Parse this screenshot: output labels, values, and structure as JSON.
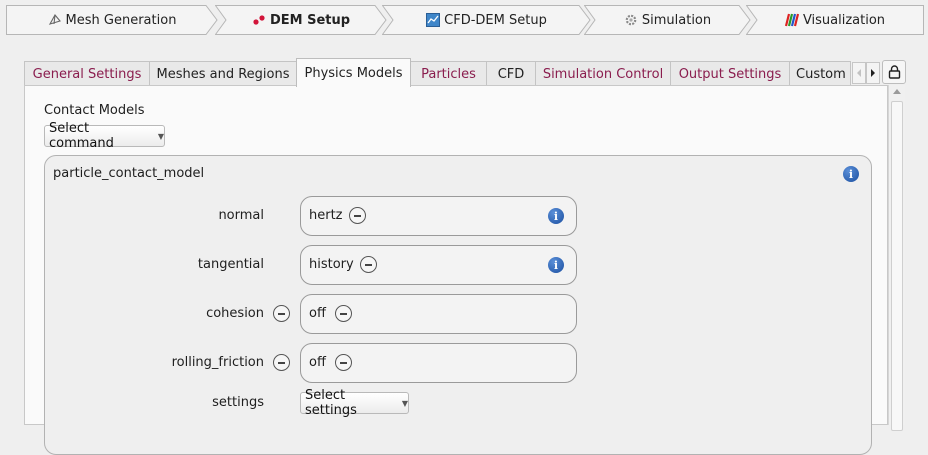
{
  "workflow": {
    "steps": [
      {
        "label": "Mesh Generation",
        "icon": "mesh-icon"
      },
      {
        "label": "DEM Setup",
        "icon": "particles-icon",
        "active": true
      },
      {
        "label": "CFD-DEM Setup",
        "icon": "chart-icon"
      },
      {
        "label": "Simulation",
        "icon": "gear-icon"
      },
      {
        "label": "Visualization",
        "icon": "paraview-icon"
      }
    ]
  },
  "tabs": [
    {
      "label": "General Settings"
    },
    {
      "label": "Meshes and Regions"
    },
    {
      "label": "Physics Models"
    },
    {
      "label": "Particles"
    },
    {
      "label": "CFD"
    },
    {
      "label": "Simulation Control"
    },
    {
      "label": "Output Settings"
    },
    {
      "label": "Custom"
    }
  ],
  "main": {
    "section_label": "Contact Models",
    "command_combo": "Select command",
    "group": {
      "title": "particle_contact_model",
      "rows": [
        {
          "label": "normal",
          "value": "hertz"
        },
        {
          "label": "tangential",
          "value": "history"
        },
        {
          "label": "cohesion",
          "value": "off"
        },
        {
          "label": "rolling_friction",
          "value": "off"
        }
      ],
      "settings_label": "settings",
      "settings_combo": "Select settings"
    }
  },
  "colors": {
    "tab_text": "#8a1d4e",
    "info_blue": "#1b4fa0",
    "accent_red": "#d2143a"
  }
}
